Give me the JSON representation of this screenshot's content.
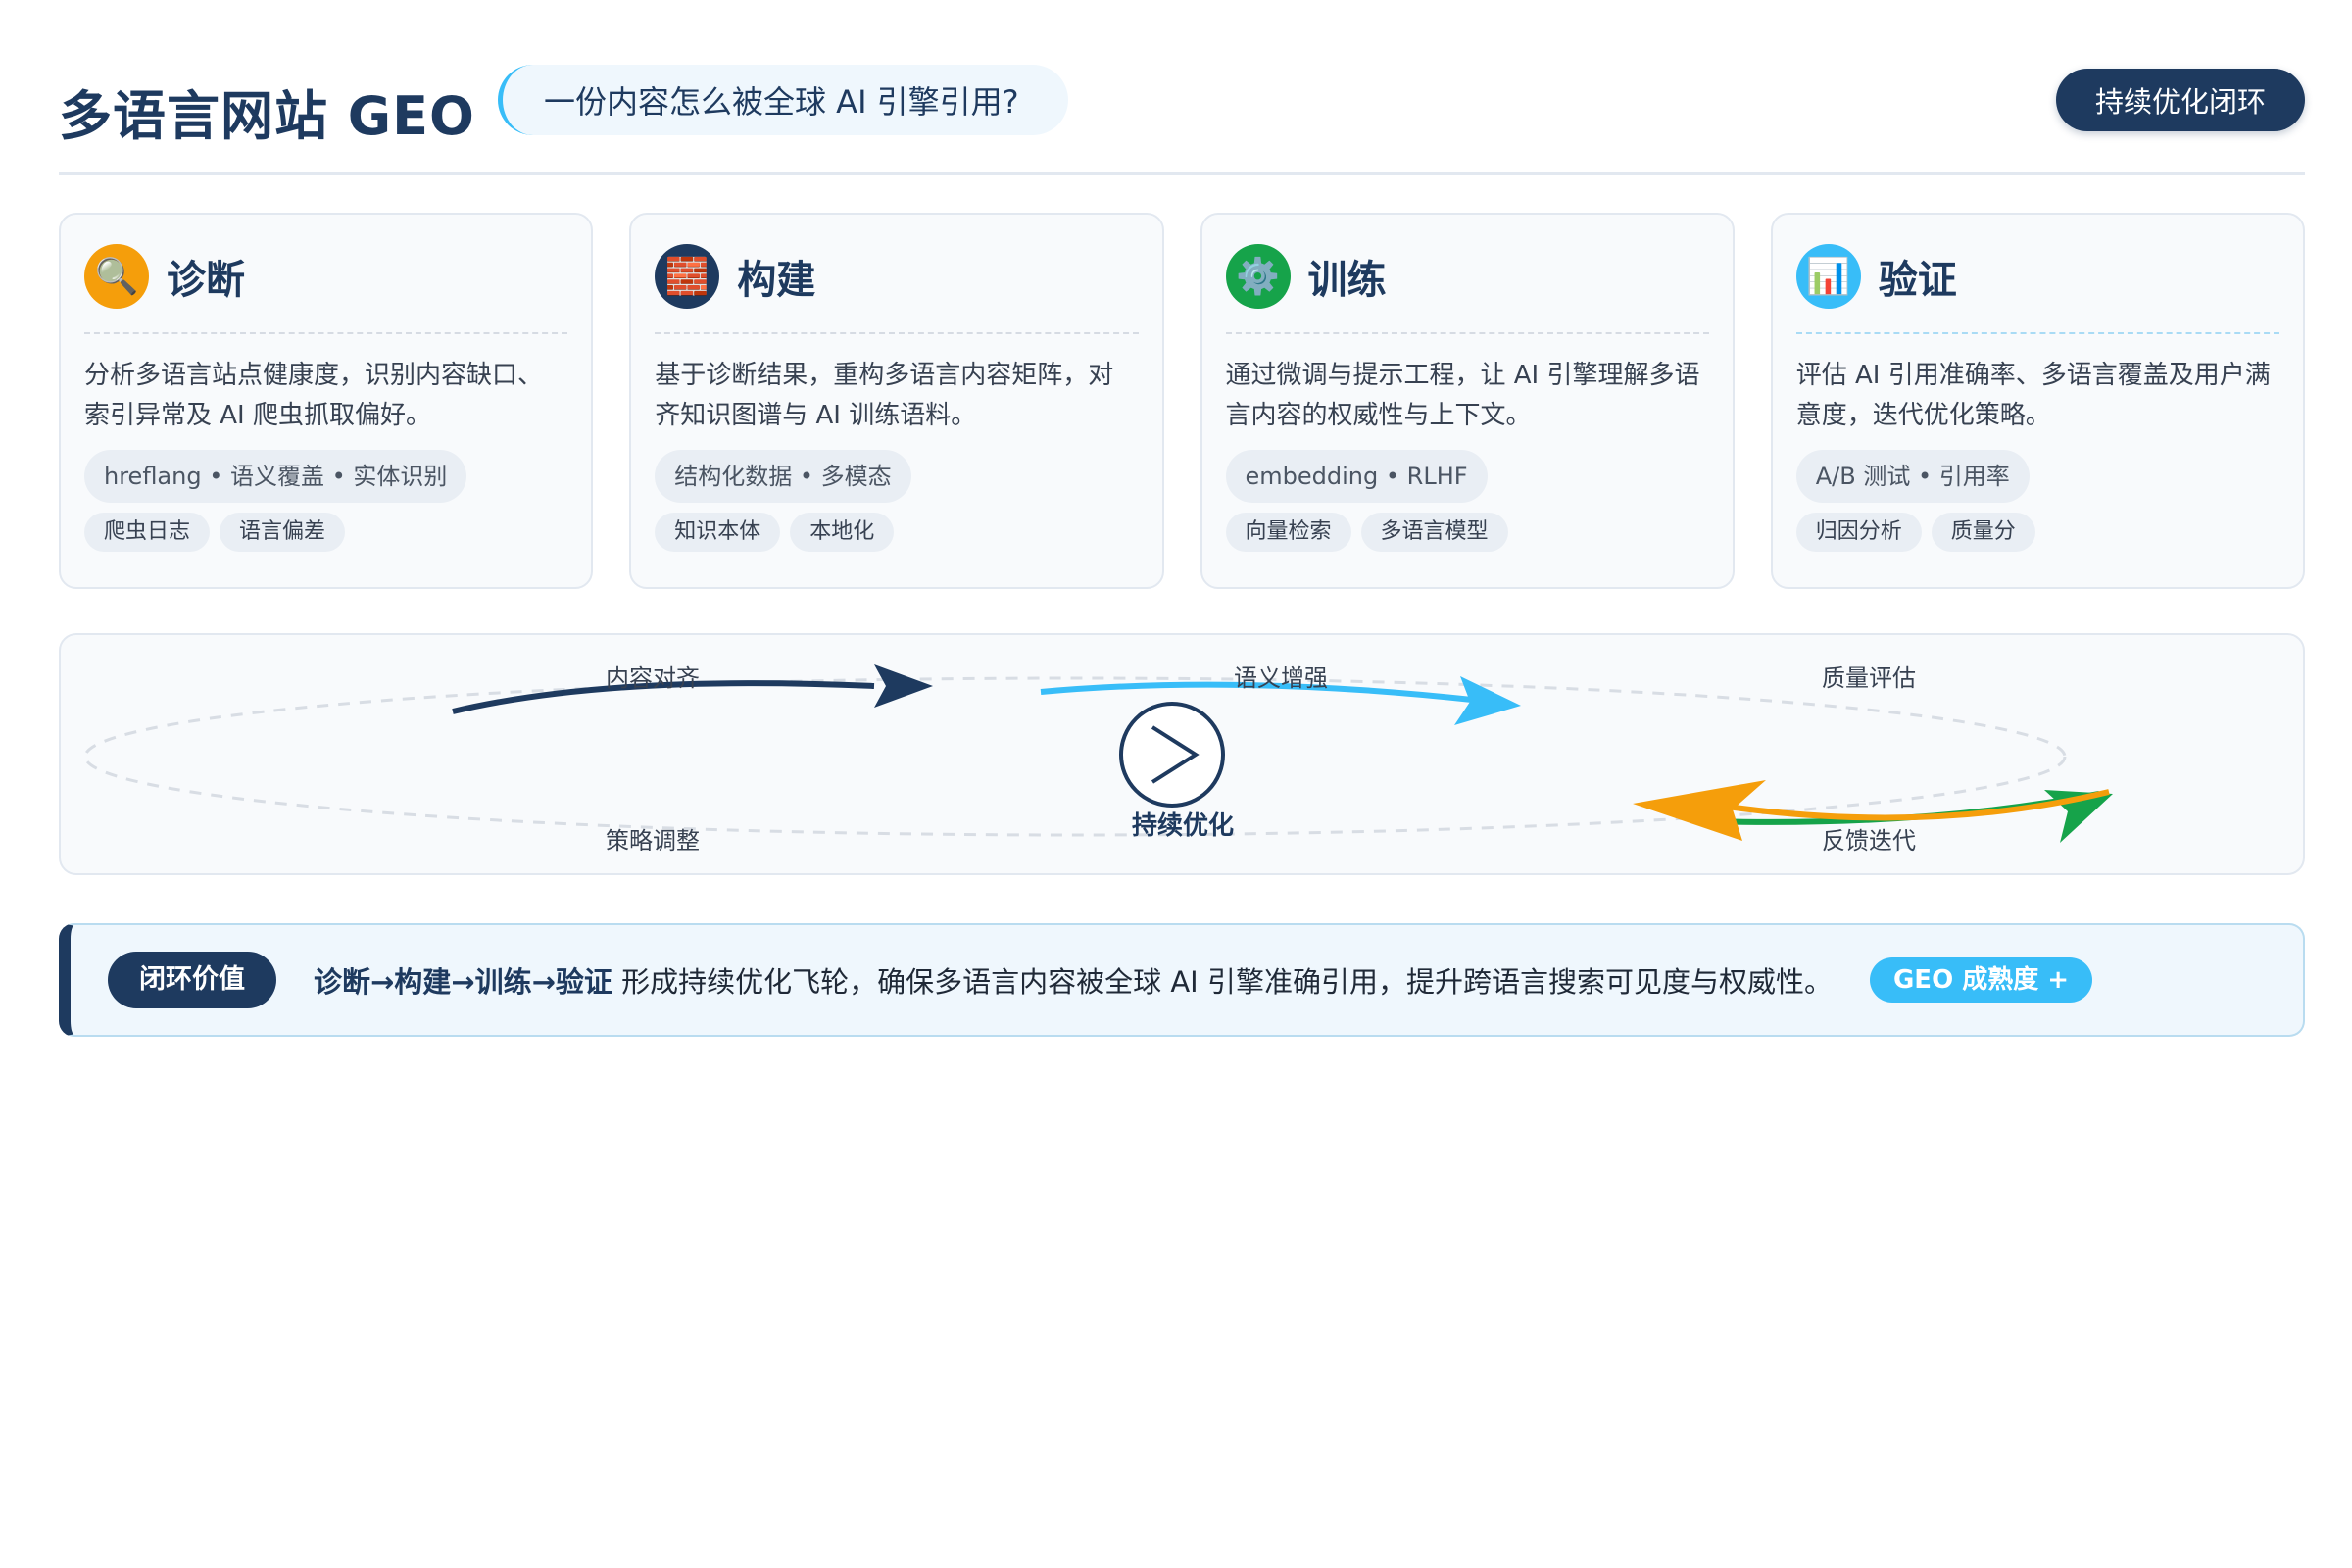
{
  "header": {
    "title": "多语言网站 GEO",
    "subtitle": "一份内容怎么被全球 AI 引擎引用?",
    "loop_button": "持续优化闭环"
  },
  "cards": [
    {
      "title": "诊断",
      "icon": "magnifier-icon",
      "icon_bg": "#f59e0b",
      "desc": "分析多语言站点健康度，识别内容缺口、索引异常及 AI 爬虫抓取偏好。",
      "tag_main": "hreflang • 语义覆盖 • 实体识别",
      "tags": [
        "爬虫日志",
        "语言偏差"
      ]
    },
    {
      "title": "构建",
      "icon": "bricks-icon",
      "icon_bg": "#1e3a5f",
      "desc": "基于诊断结果，重构多语言内容矩阵，对齐知识图谱与 AI 训练语料。",
      "tag_main": "结构化数据 • 多模态",
      "tags": [
        "知识本体",
        "本地化"
      ]
    },
    {
      "title": "训练",
      "icon": "gear-icon",
      "icon_bg": "#16a34a",
      "desc": "通过微调与提示工程，让 AI 引擎理解多语言内容的权威性与上下文。",
      "tag_main": "embedding • RLHF",
      "tags": [
        "向量检索",
        "多语言模型"
      ]
    },
    {
      "title": "验证",
      "icon": "bar-chart-icon",
      "icon_bg": "#38bdf8",
      "desc": "评估 AI 引用准确率、多语言覆盖及用户满意度，迭代优化策略。",
      "tag_main": "A/B 测试 • 引用率",
      "tags": [
        "归因分析",
        "质量分"
      ]
    }
  ],
  "cycle": {
    "labels": [
      "内容对齐",
      "语义增强",
      "质量评估",
      "策略调整",
      "反馈迭代"
    ],
    "center": "持续优化",
    "colors": {
      "navy": "#1e3a5f",
      "blue": "#38bdf8",
      "orange": "#f59e0b",
      "green": "#16a34a"
    }
  },
  "summary": {
    "badge": "闭环价值",
    "bold": "诊断→构建→训练→验证",
    "text": " 形成持续优化飞轮，确保多语言内容被全球 AI 引擎准确引用，提升跨语言搜索可见度与权威性。",
    "chip": "GEO 成熟度 +"
  }
}
